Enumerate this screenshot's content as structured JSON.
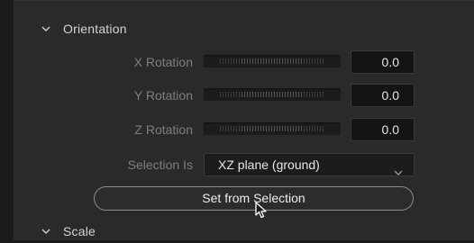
{
  "orientation": {
    "title": "Orientation",
    "rows": [
      {
        "label": "X Rotation",
        "value": "0.0"
      },
      {
        "label": "Y Rotation",
        "value": "0.0"
      },
      {
        "label": "Z Rotation",
        "value": "0.0"
      }
    ],
    "selection": {
      "label": "Selection Is",
      "value": "XZ plane (ground)"
    },
    "set_button_label": "Set from Selection"
  },
  "scale": {
    "title": "Scale"
  },
  "colors": {
    "panel": "#2a2a2d",
    "field": "#141416",
    "label": "#7e7e82",
    "text": "#e6e6e8"
  },
  "icons": {
    "expand": "chevron-down-icon",
    "dropdown": "chevron-down-icon",
    "pointer": "mouse-pointer-icon"
  }
}
